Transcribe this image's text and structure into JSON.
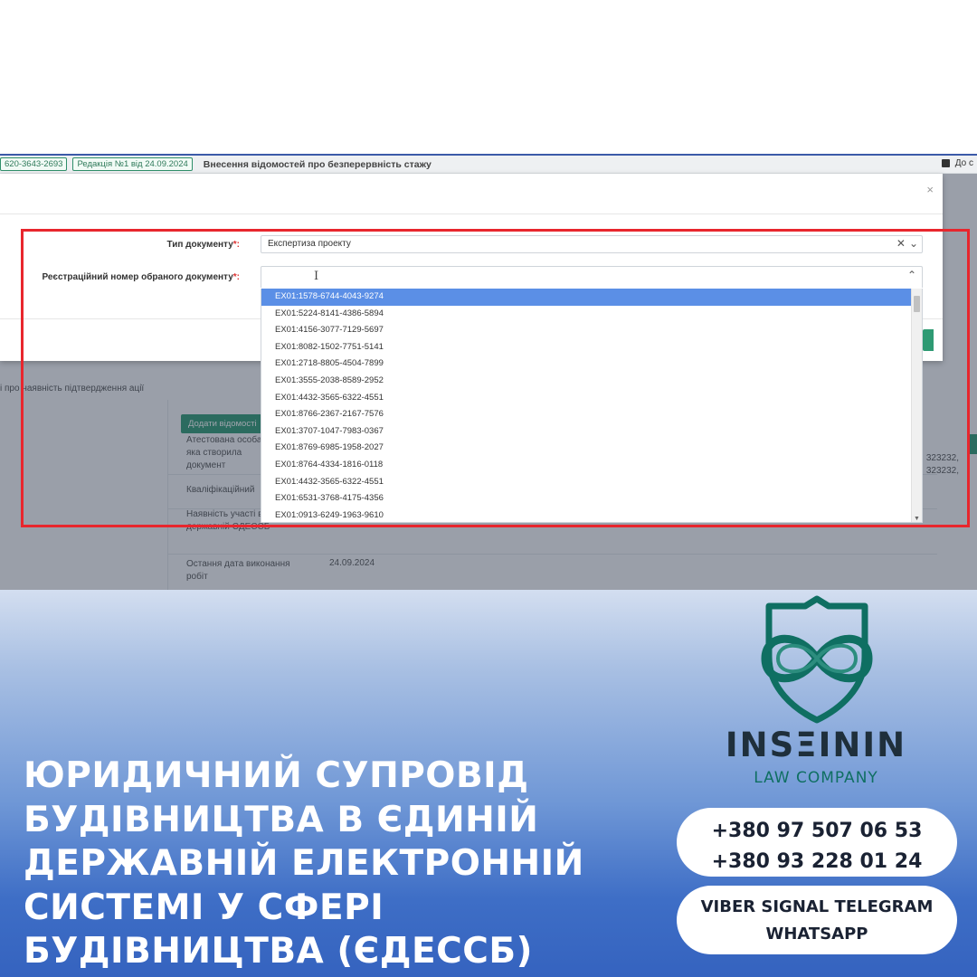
{
  "topbar": {
    "code_badge": "620-3643-2693",
    "edition_badge": "Редакція №1 від 24.09.2024",
    "title": "Внесення відомостей про безперервність стажу",
    "right_text": "До с"
  },
  "background_page": {
    "left_text": "і про наявність підтвердження ації",
    "add_button": "Додати відомості",
    "rows": [
      {
        "label": "Атестована особа, яка створила документ"
      },
      {
        "label": "Кваліфікаційний"
      },
      {
        "label": "Наявність участі в єдиній державній ЄДЕССБ"
      },
      {
        "label": "Остання дата виконання робіт",
        "value": "24.09.2024"
      }
    ],
    "right_numbers": [
      "323232,",
      "323232,"
    ]
  },
  "modal": {
    "close_icon": "close-icon",
    "doc_type_label": "Тип документу",
    "doc_type_value": "Експертиза проекту",
    "reg_number_label": "Реєстраційний номер обраного документу",
    "required_mark": "*:",
    "caret": "I"
  },
  "dropdown": {
    "selected_index": 0,
    "options": [
      "EX01:1578-6744-4043-9274",
      "EX01:5224-8141-4386-5894",
      "EX01:4156-3077-7129-5697",
      "EX01:8082-1502-7751-5141",
      "EX01:2718-8805-4504-7899",
      "EX01:3555-2038-8589-2952",
      "EX01:4432-3565-6322-4551",
      "EX01:8766-2367-2167-7576",
      "EX01:3707-1047-7983-0367",
      "EX01:8769-6985-1958-2027",
      "EX01:8764-4334-1816-0118",
      "EX01:4432-3565-6322-4551",
      "EX01:6531-3768-4175-4356",
      "EX01:0913-6249-1963-9610"
    ]
  },
  "promo": {
    "headline_lines": [
      "ЮРИДИЧНИЙ СУПРОВІД",
      "БУДІВНИЦТВА В ЄДИНІЙ",
      "ДЕРЖАВНІЙ ЕЛЕКТРОННІЙ",
      "СИСТЕМІ У СФЕРІ",
      "БУДІВНИЦТВА (ЄДЕССБ)"
    ],
    "brand": "INSΞININ",
    "brand_sub": "LAW COMPANY",
    "phones": [
      "+380 97 507 06 53",
      "+380 93 228 01 24"
    ],
    "messengers": [
      "VIBER SIGNAL TELEGRAM",
      "WHATSAPP"
    ],
    "colors": {
      "brand_teal": "#0f6f62",
      "highlight_red": "#e8262d",
      "selected_blue": "#5b8fe6"
    }
  }
}
